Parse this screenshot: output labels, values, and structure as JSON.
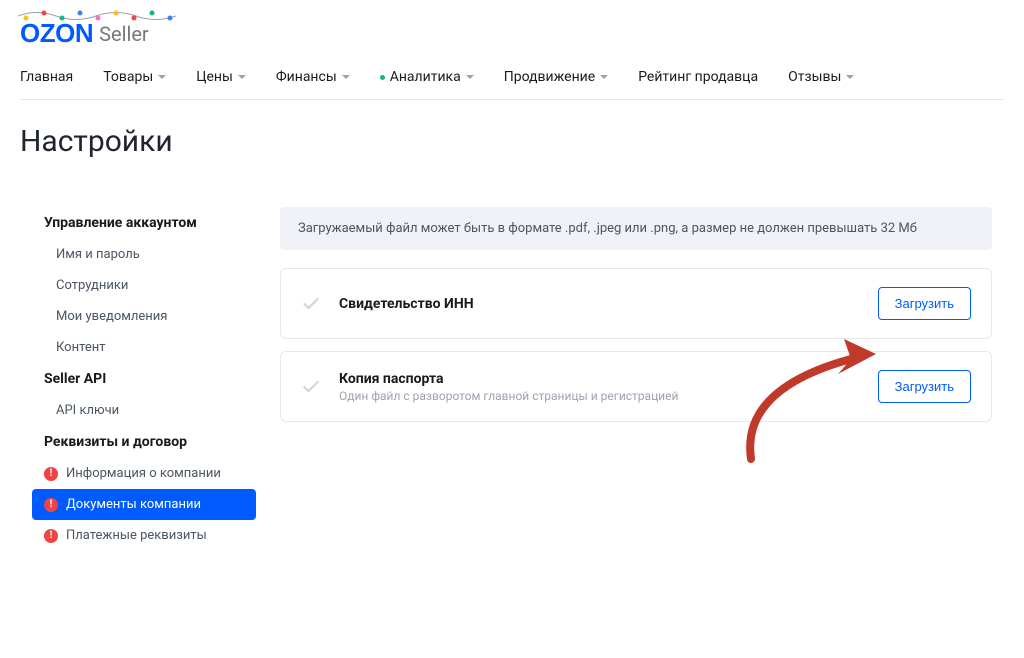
{
  "logo": {
    "brand": "OZON",
    "suffix": "Seller"
  },
  "nav": [
    {
      "label": "Главная",
      "dropdown": false,
      "dot": false
    },
    {
      "label": "Товары",
      "dropdown": true,
      "dot": false
    },
    {
      "label": "Цены",
      "dropdown": true,
      "dot": false
    },
    {
      "label": "Финансы",
      "dropdown": true,
      "dot": false
    },
    {
      "label": "Аналитика",
      "dropdown": true,
      "dot": true
    },
    {
      "label": "Продвижение",
      "dropdown": true,
      "dot": false
    },
    {
      "label": "Рейтинг продавца",
      "dropdown": false,
      "dot": false
    },
    {
      "label": "Отзывы",
      "dropdown": true,
      "dot": false
    }
  ],
  "page_title": "Настройки",
  "sidebar": {
    "sections": [
      {
        "title": "Управление аккаунтом",
        "items": [
          {
            "label": "Имя и пароль",
            "badge": false,
            "active": false
          },
          {
            "label": "Сотрудники",
            "badge": false,
            "active": false
          },
          {
            "label": "Мои уведомления",
            "badge": false,
            "active": false
          },
          {
            "label": "Контент",
            "badge": false,
            "active": false
          }
        ]
      },
      {
        "title": "Seller API",
        "items": [
          {
            "label": "API ключи",
            "badge": false,
            "active": false
          }
        ]
      },
      {
        "title": "Реквизиты и договор",
        "items": [
          {
            "label": "Информация о компании",
            "badge": true,
            "active": false
          },
          {
            "label": "Документы компании",
            "badge": true,
            "active": true
          },
          {
            "label": "Платежные реквизиты",
            "badge": true,
            "active": false
          }
        ]
      }
    ]
  },
  "main": {
    "notice": "Загружаемый файл может быть в формате .pdf, .jpeg или .png, а размер не должен превышать 32 Мб",
    "documents": [
      {
        "title": "Свидетельство ИНН",
        "subtitle": "",
        "button": "Загрузить"
      },
      {
        "title": "Копия паспорта",
        "subtitle": "Один файл с разворотом главной страницы и регистрацией",
        "button": "Загрузить"
      }
    ]
  }
}
